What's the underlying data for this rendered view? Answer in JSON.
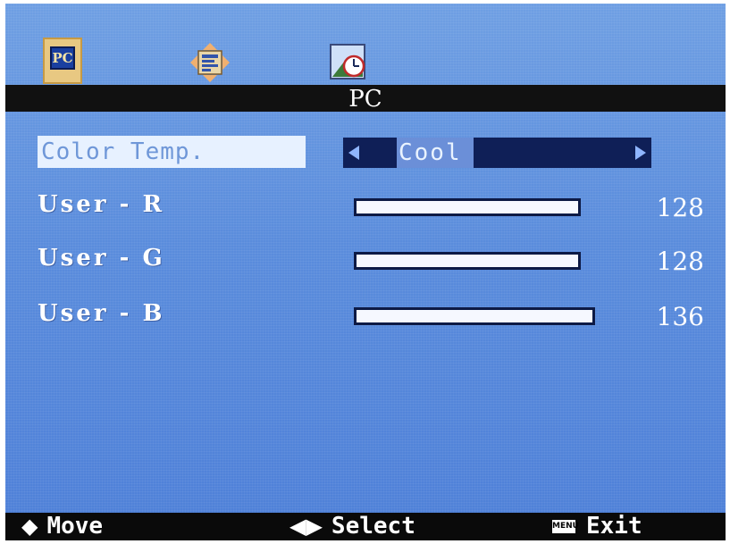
{
  "header": {
    "tabs": [
      {
        "icon": "pc-icon",
        "glyph": "PC",
        "active": true
      },
      {
        "icon": "setup-icon",
        "active": false
      },
      {
        "icon": "clock-icon",
        "active": false
      }
    ],
    "title": "PC"
  },
  "menu": {
    "color_temp": {
      "label": "Color Temp.",
      "value": "Cool"
    },
    "rows": [
      {
        "label": "User - R",
        "value": "128",
        "level": 128
      },
      {
        "label": "User - G",
        "value": "128",
        "level": 128
      },
      {
        "label": "User - B",
        "value": "136",
        "level": 136
      }
    ]
  },
  "footer": {
    "move_label": "Move",
    "move_icon": "up-down-arrow-icon",
    "select_label": "Select",
    "select_icon": "left-right-arrow-icon",
    "menu_key": "MENU",
    "exit_label": "Exit"
  },
  "colors": {
    "background": "#5a8cdc",
    "title_bar": "#111111",
    "selector": "#0f1f57",
    "highlight": "#e7f1ff",
    "slider_fill": "#f6f8ff"
  }
}
